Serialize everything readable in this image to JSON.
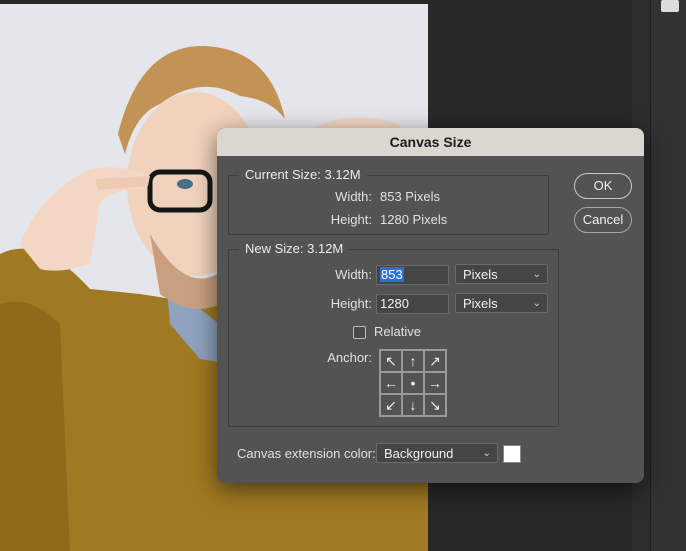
{
  "dialog": {
    "title": "Canvas Size",
    "current_size": {
      "legend": "Current Size: 3.12M",
      "width_label": "Width:",
      "width_value": "853 Pixels",
      "height_label": "Height:",
      "height_value": "1280 Pixels"
    },
    "new_size": {
      "legend": "New Size: 3.12M",
      "width_label": "Width:",
      "width_value": "853",
      "width_unit": "Pixels",
      "height_label": "Height:",
      "height_value": "1280",
      "height_unit": "Pixels",
      "relative_label": "Relative",
      "relative_checked": false,
      "anchor_label": "Anchor:",
      "anchor_arrows": [
        "↖",
        "↑",
        "↗",
        "←",
        "•",
        "→",
        "↙",
        "↓",
        "↘"
      ]
    },
    "extension": {
      "label": "Canvas extension color:",
      "value": "Background",
      "swatch_color": "#ffffff"
    },
    "buttons": {
      "ok": "OK",
      "cancel": "Cancel"
    }
  },
  "colors": {
    "dialog_bg": "#535353",
    "titlebar_bg": "#dcd6d0",
    "workspace_bg": "#282828",
    "selection": "#2f6fd1"
  }
}
